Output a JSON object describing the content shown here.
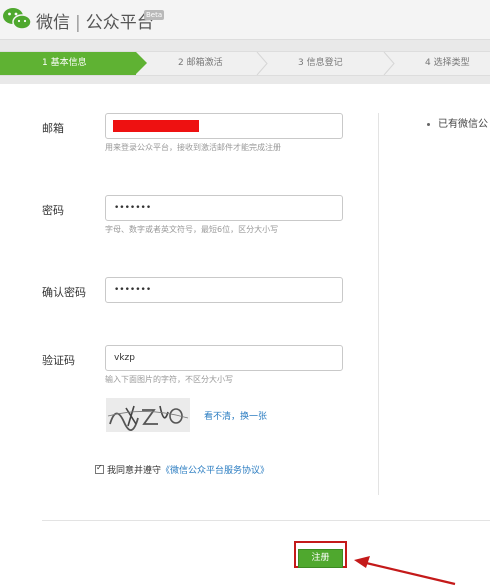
{
  "header": {
    "brand_left": "微信",
    "brand_sep": "|",
    "brand_right": "公众平台",
    "badge": "Beta"
  },
  "steps": [
    {
      "label": "1 基本信息",
      "active": true
    },
    {
      "label": "2 邮箱激活",
      "active": false
    },
    {
      "label": "3 信息登记",
      "active": false
    },
    {
      "label": "4 选择类型",
      "active": false
    }
  ],
  "form": {
    "email": {
      "label": "邮箱",
      "value": "",
      "hint": "用来登录公众平台，接收到激活邮件才能完成注册"
    },
    "password": {
      "label": "密码",
      "value": "•••••••",
      "hint": "字母、数字或者英文符号，最短6位，区分大小写"
    },
    "confirm": {
      "label": "确认密码",
      "value": "•••••••"
    },
    "captcha": {
      "label": "验证码",
      "value": "vkzp",
      "hint": "输入下面图片的字符，不区分大小写",
      "refresh": "看不清，换一张"
    },
    "agree": {
      "text": "我同意并遵守",
      "link": "《微信公众平台服务协议》"
    },
    "submit": "注册"
  },
  "side": {
    "text": "已有微信公"
  }
}
